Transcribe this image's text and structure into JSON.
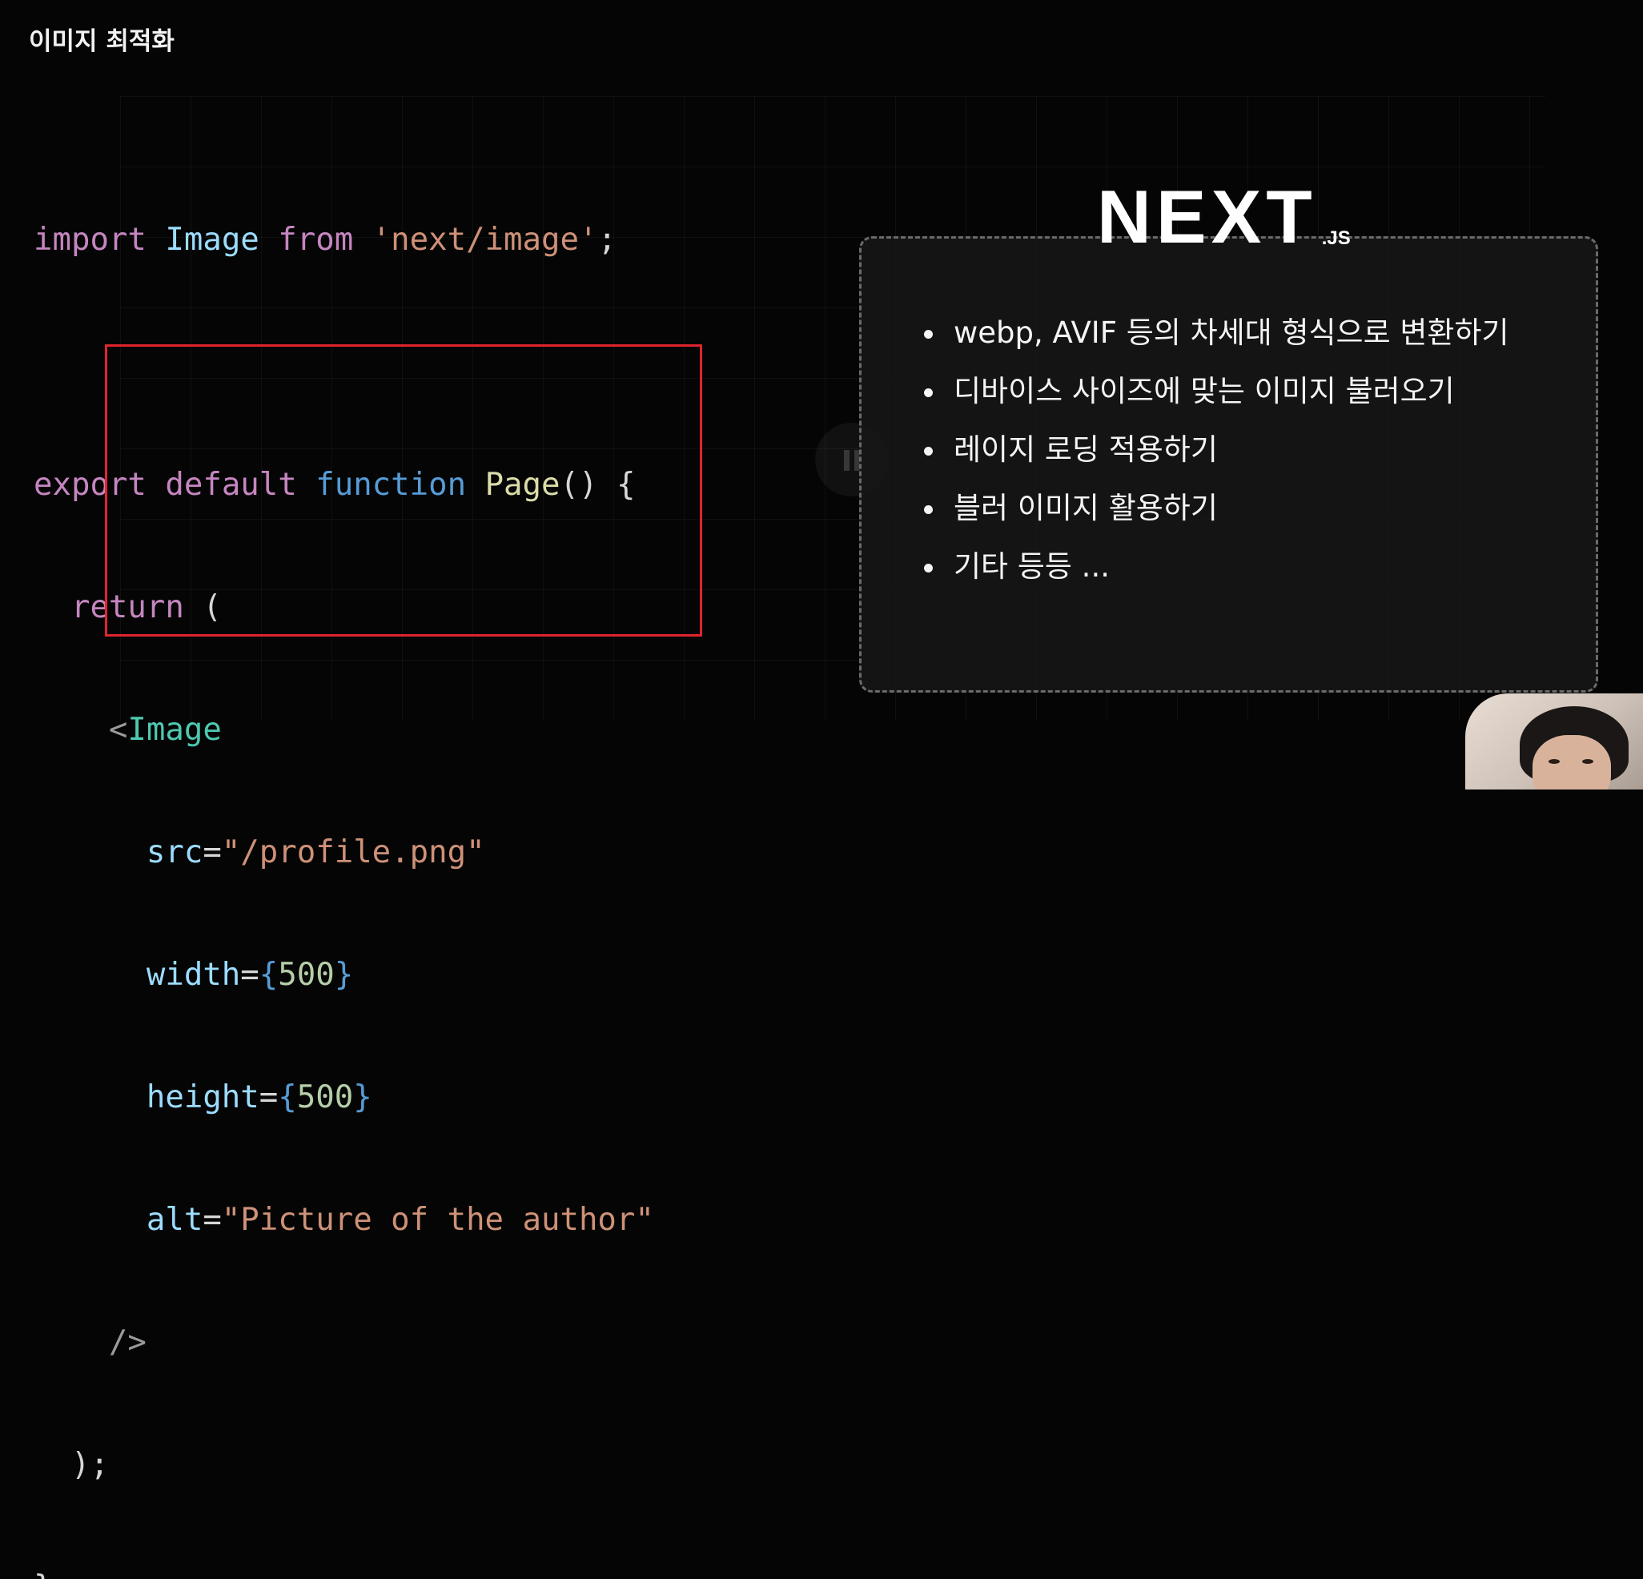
{
  "slide": {
    "title": "이미지 최적화"
  },
  "code": {
    "line1": {
      "kw": "import",
      "name": "Image",
      "from": "from",
      "module": "'next/image'",
      "semi": ";"
    },
    "line2": {
      "export": "export",
      "default": "default",
      "function": "function",
      "name": "Page",
      "parens": "()",
      "brace": "{"
    },
    "line3": {
      "return": "return",
      "paren": "("
    },
    "line4": {
      "open": "<",
      "tag": "Image"
    },
    "line5": {
      "attr": "src",
      "eq": "=",
      "value": "\"/profile.png\""
    },
    "line6": {
      "attr": "width",
      "eq": "=",
      "lbrace": "{",
      "value": "500",
      "rbrace": "}"
    },
    "line7": {
      "attr": "height",
      "eq": "=",
      "lbrace": "{",
      "value": "500",
      "rbrace": "}"
    },
    "line8": {
      "attr": "alt",
      "eq": "=",
      "value": "\"Picture of the author\""
    },
    "line9": {
      "close": "/>"
    },
    "line10": {
      "close": ");"
    },
    "line11": {
      "close": "}"
    }
  },
  "logo": {
    "main": "NEXT",
    "sub": ".JS"
  },
  "features": [
    "webp, AVIF 등의 차세대 형식으로 변환하기",
    "디바이스 사이즈에 맞는 이미지 불러오기",
    "레이지 로딩 적용하기",
    "블러 이미지 활용하기",
    "기타 등등 ..."
  ],
  "colors": {
    "background": "#050505",
    "highlight_border": "#e0242e",
    "panel_border": "#6a6a6a"
  },
  "icons": {
    "pause": "pause-icon"
  }
}
